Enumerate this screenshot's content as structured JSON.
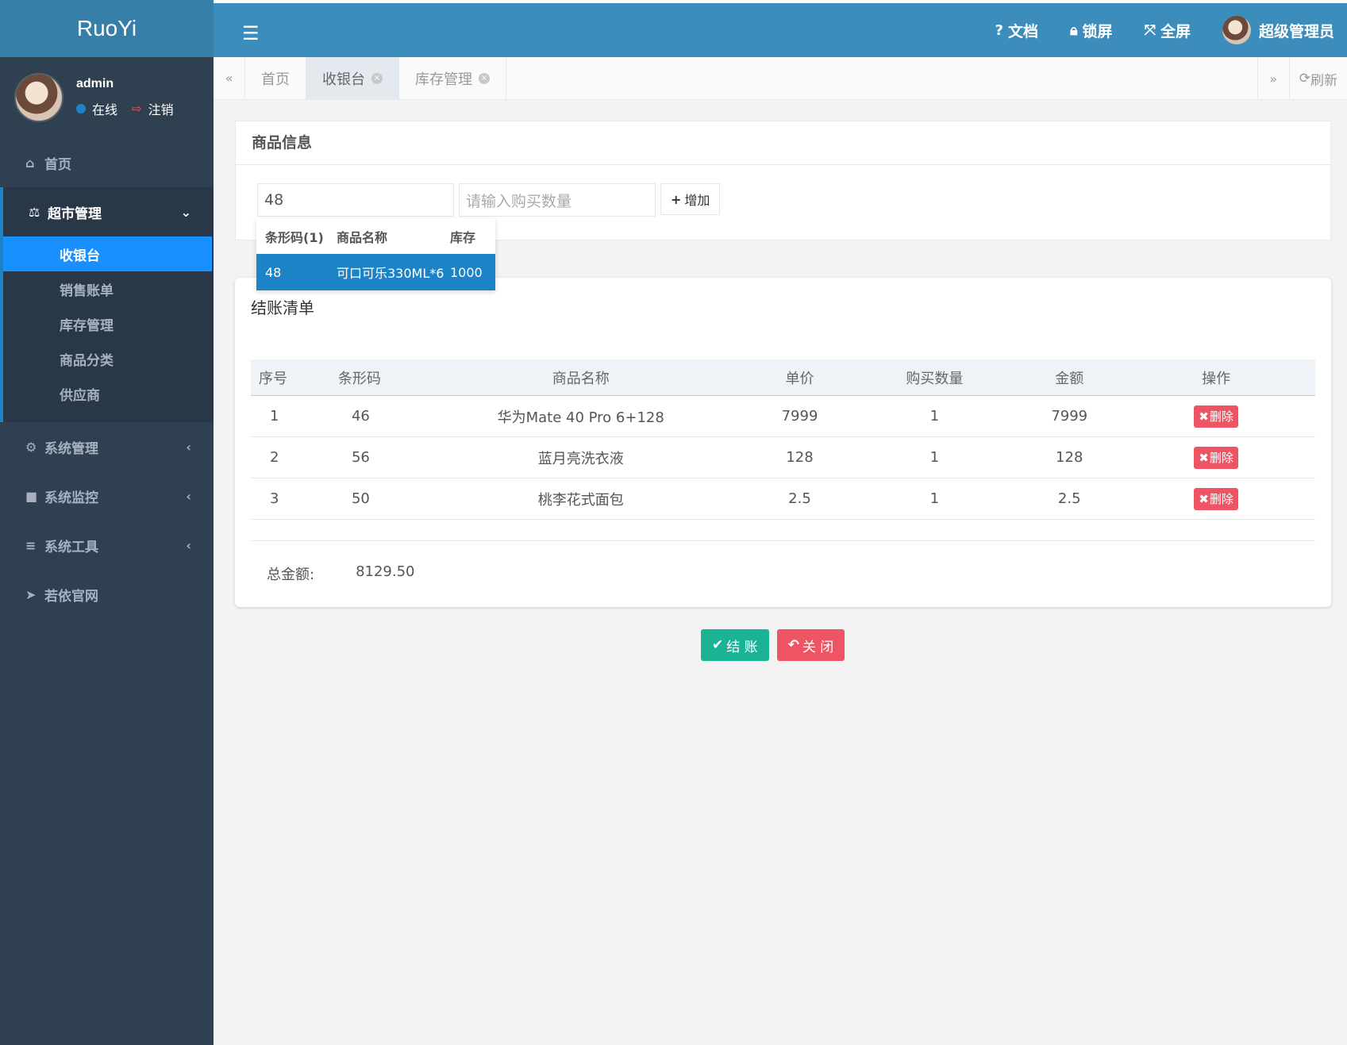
{
  "app": {
    "logo": "RuoYi"
  },
  "user_panel": {
    "name": "admin",
    "status": "在线",
    "logout": "注销"
  },
  "sidebar": {
    "home": "首页",
    "group": {
      "label": "超市管理",
      "items": [
        "收银台",
        "销售账单",
        "库存管理",
        "商品分类",
        "供应商"
      ],
      "active": "收银台"
    },
    "system_manage": "系统管理",
    "system_monitor": "系统监控",
    "system_tools": "系统工具",
    "official_site": "若依官网"
  },
  "topbar": {
    "docs": "文档",
    "lock": "锁屏",
    "fullscreen": "全屏",
    "user": "超级管理员"
  },
  "tabs": {
    "items": [
      "首页",
      "收银台",
      "库存管理"
    ],
    "active": "收银台",
    "refresh": "刷新"
  },
  "goods_card": {
    "title": "商品信息",
    "barcode_value": "48",
    "qty_placeholder": "请输入购买数量",
    "add_label": "增加"
  },
  "dropdown": {
    "headers": [
      "条形码(1)",
      "商品名称",
      "库存"
    ],
    "rows": [
      {
        "barcode": "48",
        "name": "可口可乐330ML*6",
        "stock": "1000"
      }
    ]
  },
  "checkout": {
    "title": "结账清单",
    "headers": [
      "序号",
      "条形码",
      "商品名称",
      "单价",
      "购买数量",
      "金额",
      "操作"
    ],
    "rows": [
      {
        "idx": "1",
        "barcode": "46",
        "name": "华为Mate 40 Pro 6+128",
        "price": "7999",
        "qty": "1",
        "amount": "7999",
        "op": "删除"
      },
      {
        "idx": "2",
        "barcode": "56",
        "name": "蓝月亮洗衣液",
        "price": "128",
        "qty": "1",
        "amount": "128",
        "op": "删除"
      },
      {
        "idx": "3",
        "barcode": "50",
        "name": "桃李花式面包",
        "price": "2.5",
        "qty": "1",
        "amount": "2.5",
        "op": "删除"
      }
    ],
    "total_label": "总金额:",
    "total_value": "8129.50"
  },
  "actions": {
    "checkout": "结 账",
    "close": "关 闭"
  },
  "colors": {
    "topbar": "#3c8dbc",
    "sidebar": "#2f4050",
    "active": "#1890ff",
    "danger": "#ed5565",
    "success": "#1ab394"
  }
}
